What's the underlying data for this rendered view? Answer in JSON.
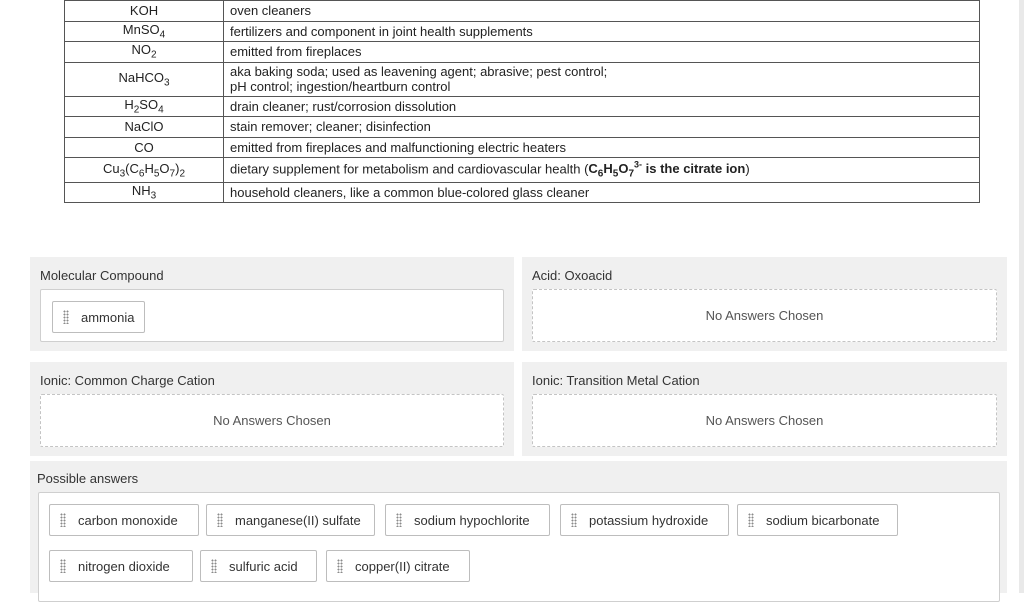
{
  "table": {
    "rows": [
      {
        "formula_html": "KOH",
        "use": "oven cleaners"
      },
      {
        "formula_html": "MnSO<sub>4</sub>",
        "use": "fertilizers and component in joint health supplements"
      },
      {
        "formula_html": "NO<sub>2</sub>",
        "use": "emitted from fireplaces"
      },
      {
        "formula_html": "NaHCO<sub>3</sub>",
        "use_line1": "aka baking soda; used as leavening agent; abrasive; pest control;",
        "use_line2": "pH control; ingestion/heartburn control"
      },
      {
        "formula_html": "H<sub>2</sub>SO<sub>4</sub>",
        "use": "drain cleaner; rust/corrosion dissolution"
      },
      {
        "formula_html": "NaClO",
        "use": "stain remover; cleaner; disinfection"
      },
      {
        "formula_html": "CO",
        "use": "emitted from fireplaces and malfunctioning electric heaters"
      },
      {
        "formula_html": "Cu<sub>3</sub>(C<sub>6</sub>H<sub>5</sub>O<sub>7</sub>)<sub>2</sub>",
        "use": "dietary supplement for metabolism and cardiovascular health (",
        "citrate_html": "C<sub>6</sub>H<sub>5</sub>O<sub>7</sub><sup>3-</sup> is the citrate ion",
        "use_end": ")"
      },
      {
        "formula_html": "NH<sub>3</sub>",
        "use": "household cleaners, like a common blue-colored glass cleaner"
      }
    ]
  },
  "categories": {
    "molecular": {
      "label": "Molecular Compound",
      "chips": [
        "ammonia"
      ]
    },
    "oxoacid": {
      "label": "Acid: Oxoacid",
      "empty_text": "No Answers Chosen"
    },
    "common_cation": {
      "label": "Ionic: Common Charge Cation",
      "empty_text": "No Answers Chosen"
    },
    "transition_cation": {
      "label": "Ionic: Transition Metal Cation",
      "empty_text": "No Answers Chosen"
    }
  },
  "possible": {
    "label": "Possible answers",
    "answers": [
      "carbon monoxide",
      "manganese(II) sulfate",
      "sodium hypochlorite",
      "potassium hydroxide",
      "sodium bicarbonate",
      "nitrogen dioxide",
      "sulfuric acid",
      "copper(II) citrate"
    ]
  }
}
